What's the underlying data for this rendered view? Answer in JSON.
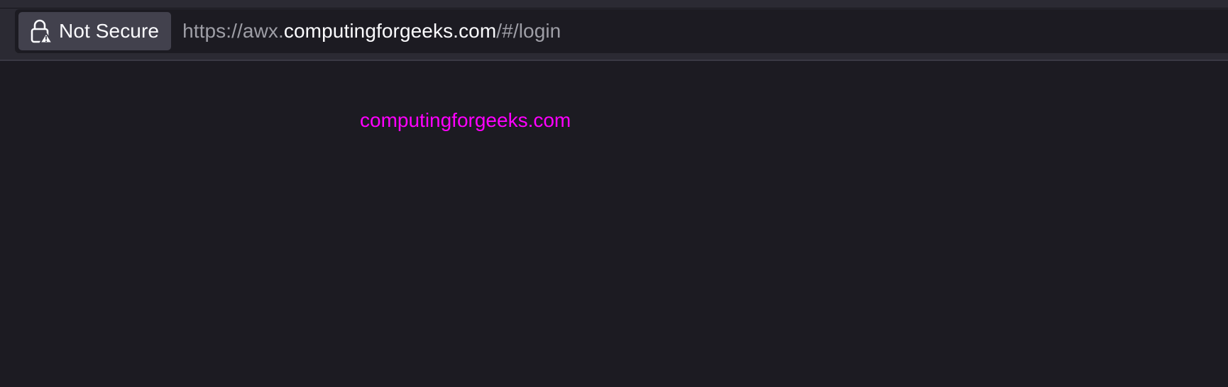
{
  "browser": {
    "security": {
      "icon": "lock-warning-icon",
      "label": "Not Secure"
    },
    "url": {
      "scheme": "https://",
      "subdomain": "awx.",
      "host": "computingforgeeks.com",
      "path": "/#/login"
    }
  },
  "page": {
    "watermark": "computingforgeeks.com"
  },
  "colors": {
    "background": "#1c1b22",
    "toolbar": "#2b2a33",
    "chip": "#42414d",
    "watermark": "#ff00ff"
  }
}
